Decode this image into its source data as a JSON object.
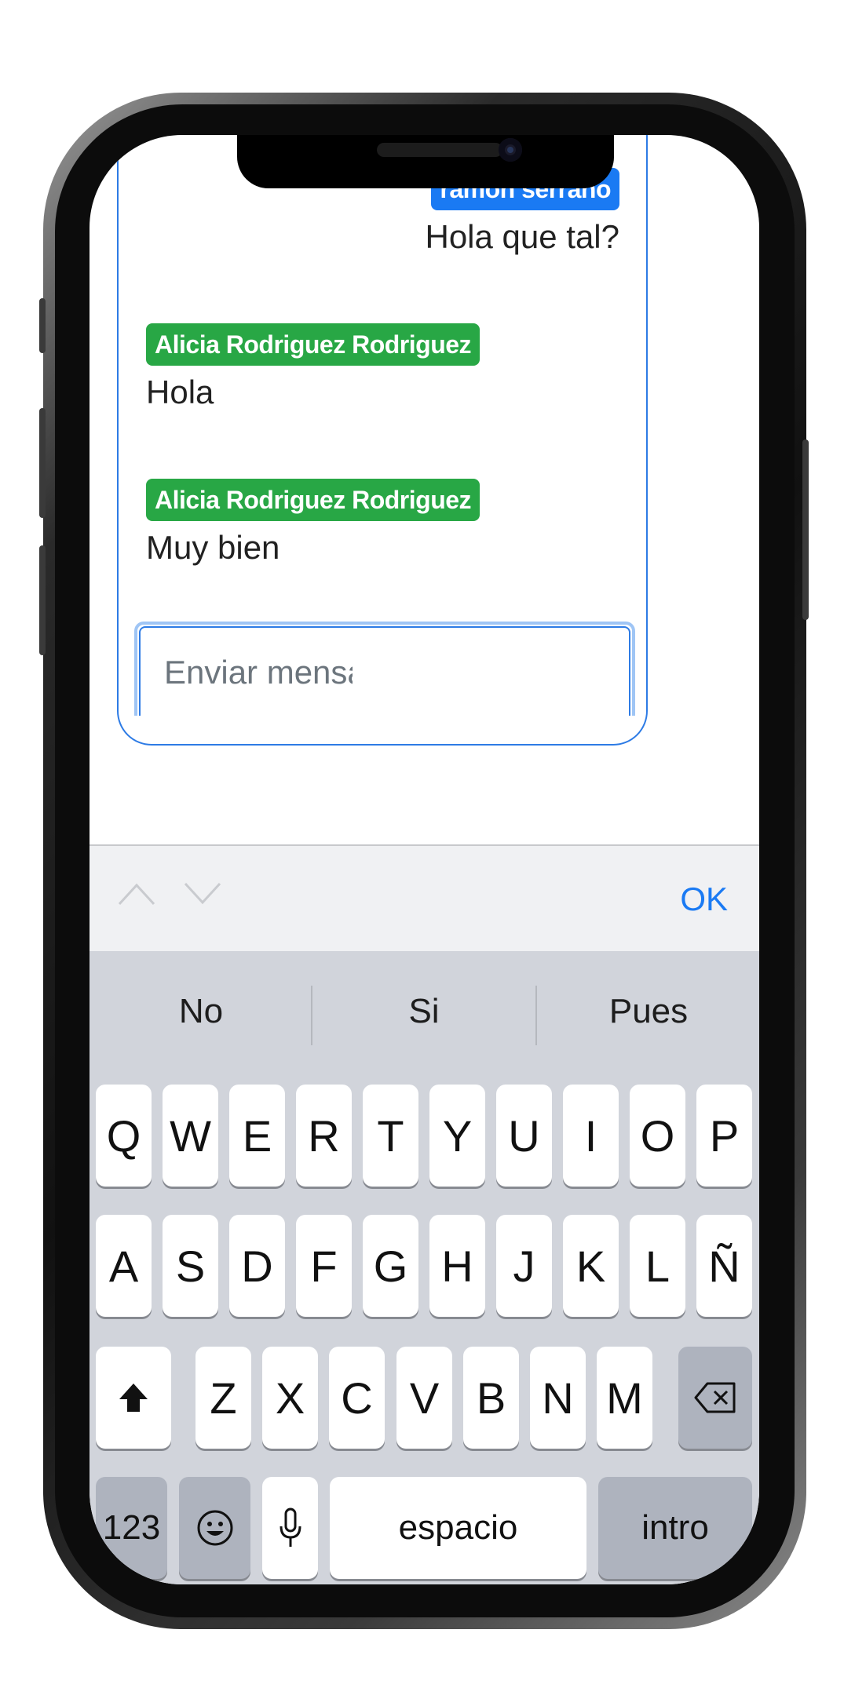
{
  "chat": {
    "messages": [
      {
        "author": "ramon serrano",
        "text": "Hola que tal?",
        "side": "right",
        "badge_color": "#1a7af3"
      },
      {
        "author": "Alicia Rodriguez Rodriguez",
        "text": "Hola",
        "side": "left",
        "badge_color": "#28a745"
      },
      {
        "author": "Alicia Rodriguez Rodriguez",
        "text": "Muy bien",
        "side": "left",
        "badge_color": "#28a745"
      }
    ],
    "input_placeholder": "Enviar mensaje"
  },
  "accessory_bar": {
    "prev_icon": "chevron-up-icon",
    "next_icon": "chevron-down-icon",
    "ok_label": "OK"
  },
  "keyboard": {
    "suggestions": [
      "No",
      "Si",
      "Pues"
    ],
    "row1": [
      "Q",
      "W",
      "E",
      "R",
      "T",
      "Y",
      "U",
      "I",
      "O",
      "P"
    ],
    "row2": [
      "A",
      "S",
      "D",
      "F",
      "G",
      "H",
      "J",
      "K",
      "L",
      "Ñ"
    ],
    "row3": [
      "Z",
      "X",
      "C",
      "V",
      "B",
      "N",
      "M"
    ],
    "shift_icon": "shift-icon",
    "backspace_icon": "backspace-icon",
    "numbers_label": "123",
    "emoji_icon": "emoji-icon",
    "mic_icon": "microphone-icon",
    "space_label": "espacio",
    "return_label": "intro"
  },
  "colors": {
    "accent": "#1a7af3",
    "green_badge": "#28a745",
    "keyboard_bg": "#d1d4db"
  }
}
